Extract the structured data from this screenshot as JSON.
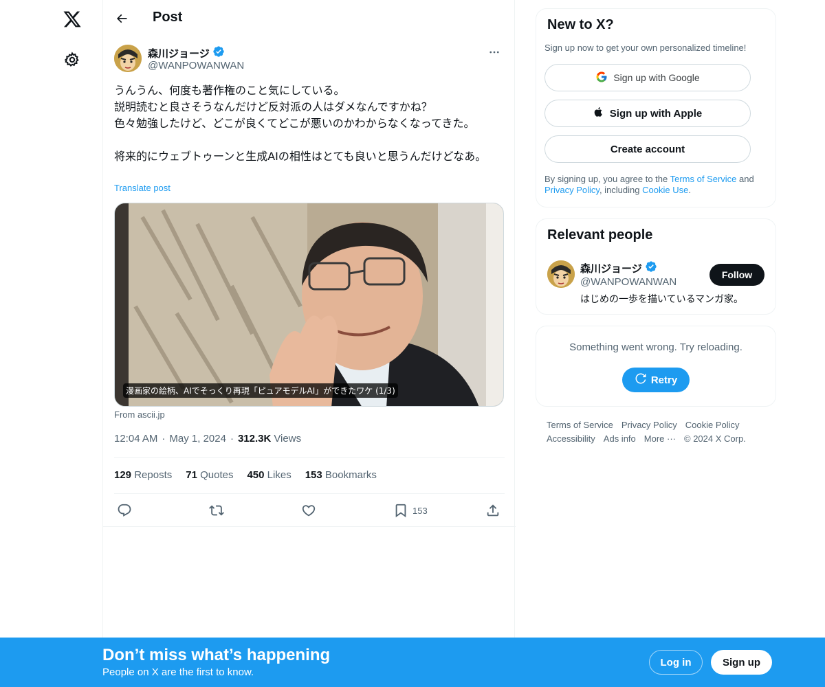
{
  "header": {
    "title": "Post"
  },
  "post": {
    "author_name": "森川ジョージ",
    "author_handle": "@WANPOWANWAN",
    "text": "うんうん、何度も著作権のこと気にしている。\n説明読むと良さそうなんだけど反対派の人はダメなんですかね？\n色々勉強したけど、どこが良くてどこが悪いのかわからなくなってきた。\n\n将来的にウェブトゥーンと生成AIの相性はとても良いと思うんだけどなあ。",
    "translate_label": "Translate post",
    "media_caption": "漫画家の絵柄、AIでそっくり再現「ピュアモデルAI」ができたワケ (1/3)",
    "media_source": "From ascii.jp",
    "time": "12:04 AM",
    "date": "May 1, 2024",
    "views_count": "312.3K",
    "views_label": "Views",
    "stats": {
      "reposts_count": "129",
      "reposts_label": "Reposts",
      "quotes_count": "71",
      "quotes_label": "Quotes",
      "likes_count": "450",
      "likes_label": "Likes",
      "bookmarks_count": "153",
      "bookmarks_label": "Bookmarks"
    },
    "bookmark_action_count": "153"
  },
  "signup": {
    "title": "New to X?",
    "subtitle": "Sign up now to get your own personalized timeline!",
    "google_label": "Sign up with Google",
    "apple_label": "Sign up with Apple",
    "create_label": "Create account",
    "terms_prefix": "By signing up, you agree to the ",
    "terms_link": "Terms of Service",
    "terms_and": " and",
    "privacy_link": "Privacy Policy",
    "terms_including": ", including ",
    "cookie_link": "Cookie Use",
    "terms_end": "."
  },
  "relevant": {
    "title": "Relevant people",
    "name": "森川ジョージ",
    "handle": "@WANPOWANWAN",
    "bio": "はじめの一歩を描いているマンガ家。",
    "follow_label": "Follow"
  },
  "error": {
    "message": "Something went wrong. Try reloading.",
    "retry_label": "Retry"
  },
  "footer": {
    "links": [
      "Terms of Service",
      "Privacy Policy",
      "Cookie Policy",
      "Accessibility",
      "Ads info",
      "More ···"
    ],
    "copyright": "© 2024 X Corp."
  },
  "bottom_bar": {
    "title": "Don’t miss what’s happening",
    "subtitle": "People on X are the first to know.",
    "login_label": "Log in",
    "signup_label": "Sign up"
  },
  "colors": {
    "accent": "#1d9bf0",
    "text": "#0f1419",
    "muted": "#536471",
    "border": "#eff3f4"
  },
  "icons": [
    "x-logo-icon",
    "gear-icon",
    "back-arrow-icon",
    "verified-icon",
    "more-icon",
    "reply-icon",
    "repost-icon",
    "like-icon",
    "bookmark-icon",
    "share-icon",
    "google-icon",
    "apple-icon",
    "retry-icon"
  ]
}
